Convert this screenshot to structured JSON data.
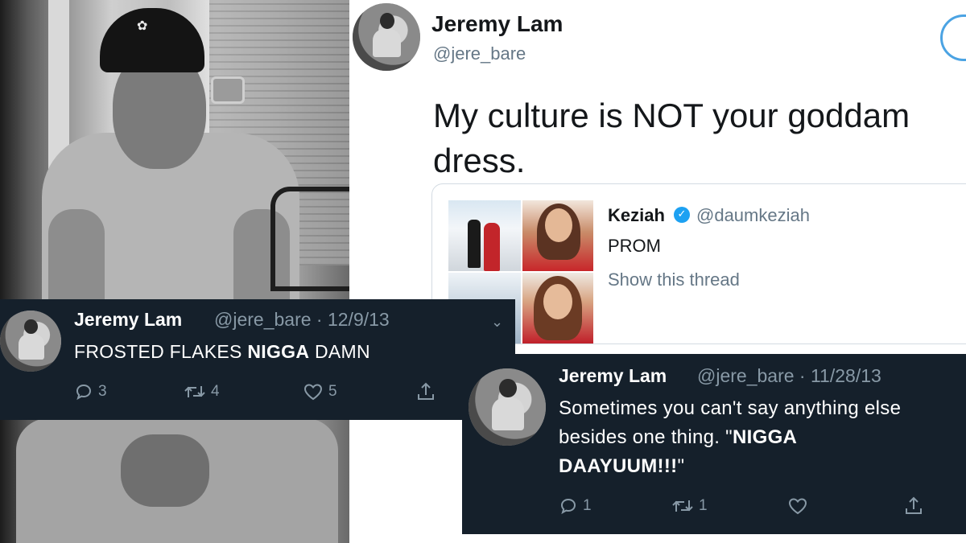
{
  "main_tweet": {
    "name": "Jeremy Lam",
    "handle": "@jere_bare",
    "text_line1": "My culture is NOT your goddam",
    "text_line2": "dress.",
    "avatar_icon": "profile-photo-avatar",
    "quoted": {
      "name": "Keziah",
      "verified_icon": "verified-badge-icon",
      "handle": "@daumkeziah",
      "text": "PROM",
      "thread_link": "Show this thread"
    }
  },
  "old_tweet_1": {
    "name": "Jeremy Lam",
    "meta": "@jere_bare · 12/9/13",
    "text_before": "FROSTED FLAKES ",
    "text_bold": "NIGGA",
    "text_after": " DAMN",
    "chevron": "⌄",
    "actions": {
      "replies": "3",
      "retweets": "4",
      "likes": "5"
    }
  },
  "old_tweet_2": {
    "name": "Jeremy Lam",
    "meta": "@jere_bare · 11/28/13",
    "text_line1": "Sometimes you can't say anything else",
    "text_line2_before": "besides one thing. \"",
    "text_line2_bold": "NIGGA",
    "text_line3_bold": "DAAYUUM!!!",
    "text_line3_after": "\"",
    "actions": {
      "replies": "1",
      "retweets": "1",
      "likes": ""
    }
  },
  "colors": {
    "dark_card_bg": "#15202b",
    "dark_meta": "#8899a6",
    "light_name": "#14171a",
    "light_meta": "#657786",
    "accent_blue": "#1da1f2"
  }
}
